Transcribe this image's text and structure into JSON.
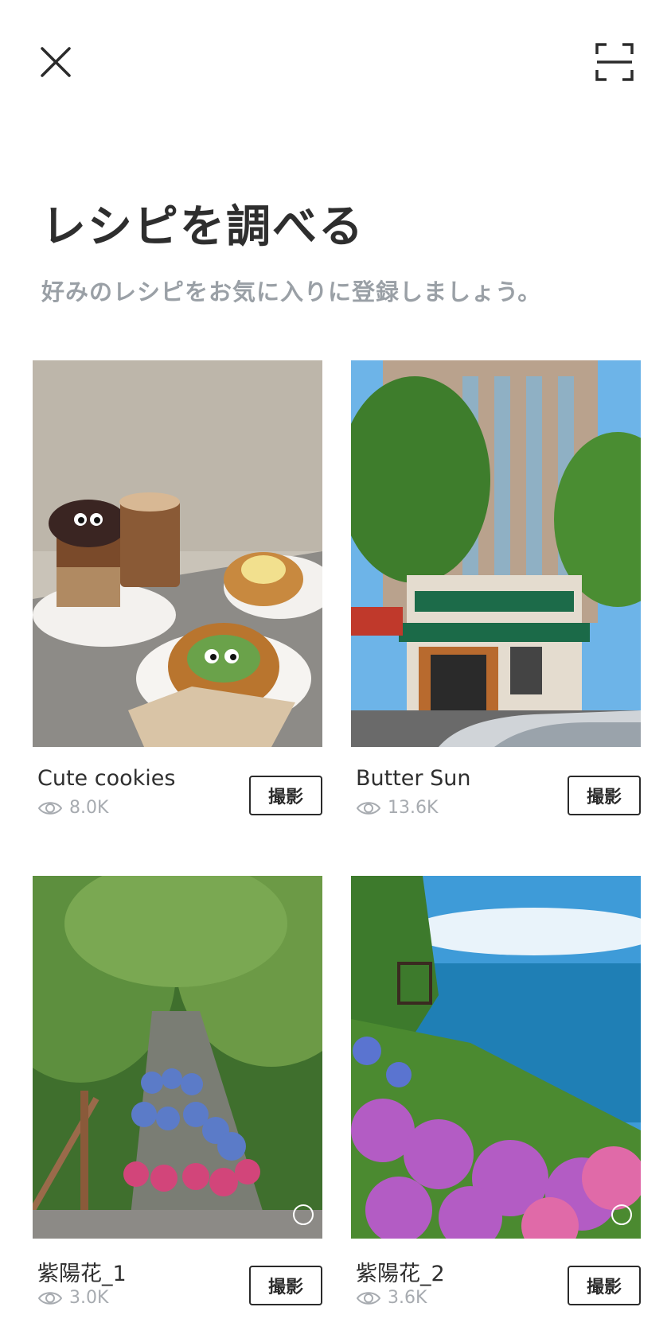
{
  "header": {
    "title": "レシピを調べる",
    "subtitle": "好みのレシピをお気に入りに登録しましょう。"
  },
  "icons": {
    "close": "close-icon",
    "scan": "scan-frame-icon",
    "views": "eye-icon"
  },
  "recipes": [
    {
      "name": "Cute cookies",
      "views": "8.0K",
      "button": "撮影"
    },
    {
      "name": "Butter Sun",
      "views": "13.6K",
      "button": "撮影"
    },
    {
      "name": "紫陽花_1",
      "views": "3.0K",
      "button": "撮影"
    },
    {
      "name": "紫陽花_2",
      "views": "3.6K",
      "button": "撮影"
    }
  ]
}
